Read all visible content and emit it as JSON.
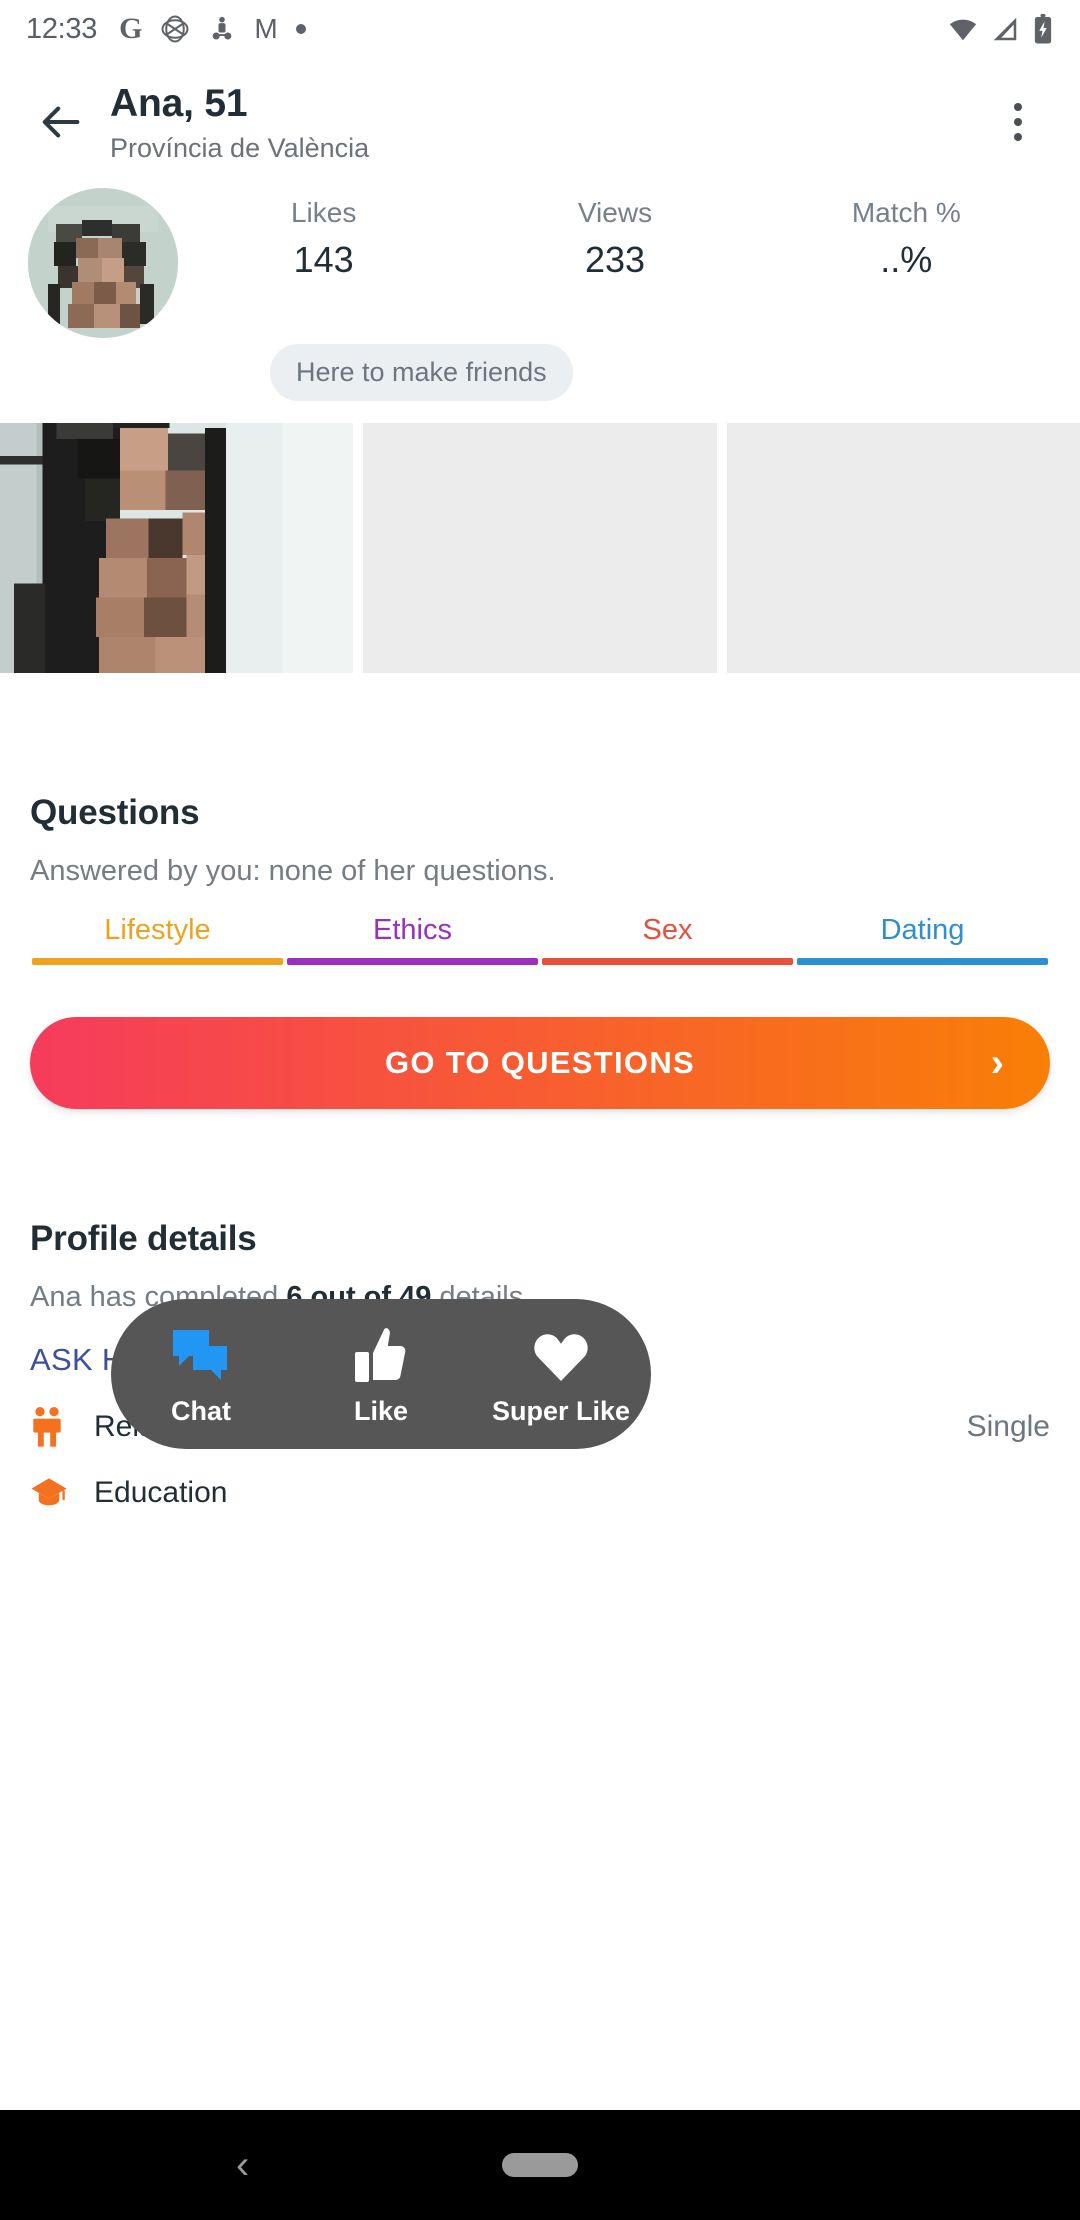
{
  "status_bar": {
    "time": "12:33",
    "left_icons": [
      "google-icon",
      "globe-icon",
      "app-icon",
      "gmail-icon",
      "dot-icon"
    ],
    "right_icons": [
      "wifi-icon",
      "signal-icon",
      "battery-charging-icon"
    ]
  },
  "app_bar": {
    "back_icon": "back-arrow-icon",
    "name": "Ana, 51",
    "location": "Província de València",
    "overflow_icon": "more-vertical-icon"
  },
  "stats": {
    "items": [
      {
        "label": "Likes",
        "value": "143"
      },
      {
        "label": "Views",
        "value": "233"
      },
      {
        "label": "Match %",
        "value": "..%"
      }
    ],
    "chip": "Here to make friends"
  },
  "gallery": {
    "tiles": [
      "photo-1",
      "photo-2-empty",
      "photo-3-empty"
    ]
  },
  "questions": {
    "title": "Questions",
    "subtitle": "Answered by you: none of her questions.",
    "tabs": [
      {
        "label": "Lifestyle",
        "color": "#eda31f"
      },
      {
        "label": "Ethics",
        "color": "#9b30bd"
      },
      {
        "label": "Sex",
        "color": "#e94f3d"
      },
      {
        "label": "Dating",
        "color": "#2e8fd0"
      }
    ],
    "cta_label": "GO TO QUESTIONS",
    "cta_chevron": "chevron-right-icon",
    "cta_gradient_from": "#f63b5c",
    "cta_gradient_to": "#f97f06"
  },
  "profile_details": {
    "title": "Profile details",
    "summary_prefix": "Ana has completed ",
    "summary_bold": "6 out of 49",
    "summary_suffix": " details.",
    "ask_link": "ASK HER TO COMPLETE HER PROFILE",
    "link_color": "#3c4fa3",
    "rows": [
      {
        "icon": "couple-icon",
        "key": "Relationship status",
        "value": "Single"
      },
      {
        "icon": "graduation-cap-icon",
        "key": "Education",
        "value": ""
      }
    ]
  },
  "action_bar": {
    "background": "#565656",
    "actions": [
      {
        "icon": "chat-bubbles-icon",
        "label": "Chat",
        "color": "#2196f3"
      },
      {
        "icon": "thumbs-up-icon",
        "label": "Like",
        "color": "#ffffff"
      },
      {
        "icon": "heart-icon",
        "label": "Super Like",
        "color": "#ffffff"
      }
    ]
  },
  "nav_bar": {
    "back_icon": "nav-back-icon",
    "home_pill": "nav-home-pill"
  }
}
